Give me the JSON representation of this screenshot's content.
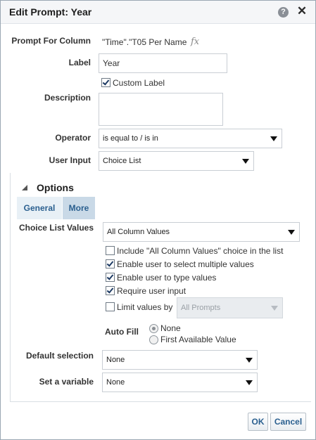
{
  "dialog": {
    "title": "Edit Prompt: Year",
    "help_icon": "question-icon",
    "close_icon": "close-icon"
  },
  "form": {
    "prompt_for_column": {
      "label": "Prompt For Column",
      "value": "\"Time\".\"T05 Per Name",
      "fx": "fx"
    },
    "label_field": {
      "label": "Label",
      "value": "Year"
    },
    "custom_label": {
      "label": "Custom Label",
      "checked": true
    },
    "description": {
      "label": "Description",
      "value": ""
    },
    "operator": {
      "label": "Operator",
      "value": "is equal to / is in"
    },
    "user_input": {
      "label": "User Input",
      "value": "Choice List"
    }
  },
  "options": {
    "header": "Options",
    "tabs": [
      {
        "label": "General"
      },
      {
        "label": "More"
      }
    ],
    "choice_list_values": {
      "label": "Choice List Values",
      "value": "All Column Values"
    },
    "checkboxes": [
      {
        "label": "Include \"All Column Values\" choice in the list",
        "checked": false
      },
      {
        "label": "Enable user to select multiple values",
        "checked": true
      },
      {
        "label": "Enable user to type values",
        "checked": true
      },
      {
        "label": "Require user input",
        "checked": true
      },
      {
        "label": "Limit values by",
        "checked": false
      }
    ],
    "limit_values_by": {
      "value": "All Prompts"
    },
    "auto_fill": {
      "label": "Auto Fill",
      "options": [
        {
          "label": "None",
          "selected": true
        },
        {
          "label": "First Available Value",
          "selected": false
        }
      ]
    },
    "default_selection": {
      "label": "Default selection",
      "value": "None"
    },
    "set_variable": {
      "label": "Set a variable",
      "value": "None"
    }
  },
  "buttons": {
    "ok": "OK",
    "cancel": "Cancel"
  }
}
